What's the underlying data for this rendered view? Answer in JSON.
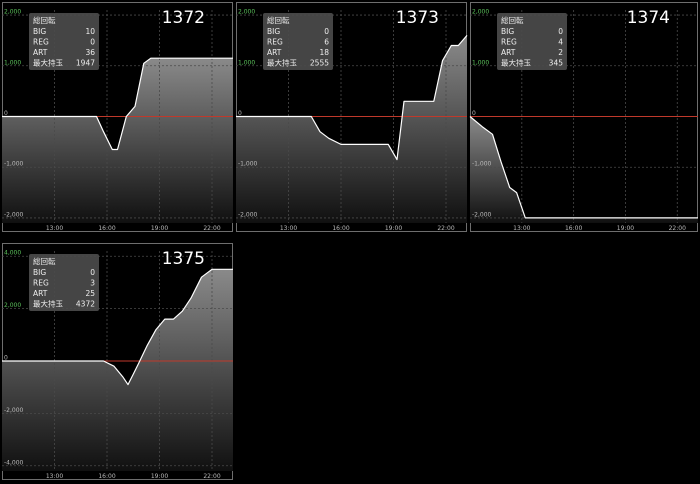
{
  "colors": {
    "background": "#000000",
    "panel_border": "#6e6e6e",
    "grid": "#4a4a4a",
    "zero_line": "#c0392b",
    "line": "#ffffff",
    "fill_top": "#8a8a8a",
    "fill_bottom": "#101010",
    "info_box": "#4b4b4b",
    "tick_positive": "#5ac05a",
    "tick_negative": "#b9b9b9"
  },
  "chart_data": [
    {
      "type": "area",
      "machine": "1372",
      "info": {
        "title": "総回転",
        "rows": [
          {
            "label": "BIG",
            "value": "10"
          },
          {
            "label": "REG",
            "value": "0"
          },
          {
            "label": "ART",
            "value": "36"
          },
          {
            "label": "最大持玉",
            "value": "1947"
          }
        ]
      },
      "xlim": [
        10,
        23.2
      ],
      "ylim": [
        -2100,
        2100
      ],
      "xticks": [
        {
          "x": 13,
          "label": "13:00"
        },
        {
          "x": 16,
          "label": "16:00"
        },
        {
          "x": 19,
          "label": "19:00"
        },
        {
          "x": 22,
          "label": "22:00"
        }
      ],
      "yticks": [
        {
          "y": 2000,
          "label": "2,000"
        },
        {
          "y": 1000,
          "label": "1,000"
        },
        {
          "y": 0,
          "label": "0"
        },
        {
          "y": -1000,
          "label": "-1,000"
        },
        {
          "y": -2000,
          "label": "-2,000"
        }
      ],
      "x": [
        10.0,
        15.4,
        15.8,
        16.3,
        16.6,
        17.1,
        17.6,
        18.1,
        18.5,
        19.0,
        20.0,
        21.0,
        22.0,
        23.2
      ],
      "y": [
        0,
        0,
        -300,
        -650,
        -650,
        0,
        200,
        1050,
        1150,
        1150,
        1150,
        1150,
        1150,
        1150
      ]
    },
    {
      "type": "area",
      "machine": "1373",
      "info": {
        "title": "総回転",
        "rows": [
          {
            "label": "BIG",
            "value": "0"
          },
          {
            "label": "REG",
            "value": "6"
          },
          {
            "label": "ART",
            "value": "18"
          },
          {
            "label": "最大持玉",
            "value": "2555"
          }
        ]
      },
      "xlim": [
        10,
        23.2
      ],
      "ylim": [
        -2100,
        2100
      ],
      "xticks": [
        {
          "x": 13,
          "label": "13:00"
        },
        {
          "x": 16,
          "label": "16:00"
        },
        {
          "x": 19,
          "label": "19:00"
        },
        {
          "x": 22,
          "label": "22:00"
        }
      ],
      "yticks": [
        {
          "y": 2000,
          "label": "2,000"
        },
        {
          "y": 1000,
          "label": "1,000"
        },
        {
          "y": 0,
          "label": "0"
        },
        {
          "y": -1000,
          "label": "-1,000"
        },
        {
          "y": -2000,
          "label": "-2,000"
        }
      ],
      "x": [
        10.0,
        13.8,
        14.3,
        14.8,
        15.3,
        16.0,
        17.0,
        18.0,
        18.7,
        19.2,
        19.6,
        20.2,
        20.8,
        21.3,
        21.8,
        22.3,
        22.7,
        23.2
      ],
      "y": [
        0,
        0,
        0,
        -300,
        -430,
        -550,
        -550,
        -550,
        -550,
        -850,
        300,
        300,
        300,
        300,
        1100,
        1400,
        1400,
        1600
      ]
    },
    {
      "type": "area",
      "machine": "1374",
      "info": {
        "title": "総回転",
        "rows": [
          {
            "label": "BIG",
            "value": "0"
          },
          {
            "label": "REG",
            "value": "4"
          },
          {
            "label": "ART",
            "value": "2"
          },
          {
            "label": "最大持玉",
            "value": "345"
          }
        ]
      },
      "xlim": [
        10,
        23.2
      ],
      "ylim": [
        -2100,
        2100
      ],
      "xticks": [
        {
          "x": 13,
          "label": "13:00"
        },
        {
          "x": 16,
          "label": "16:00"
        },
        {
          "x": 19,
          "label": "19:00"
        },
        {
          "x": 22,
          "label": "22:00"
        }
      ],
      "yticks": [
        {
          "y": 2000,
          "label": "2,000"
        },
        {
          "y": 1000,
          "label": "1,000"
        },
        {
          "y": 0,
          "label": "0"
        },
        {
          "y": -1000,
          "label": "-1,000"
        },
        {
          "y": -2000,
          "label": "-2,000"
        }
      ],
      "x": [
        10.0,
        10.7,
        11.3,
        11.8,
        12.3,
        12.7,
        13.2,
        15.0,
        18.0,
        21.0,
        23.2
      ],
      "y": [
        0,
        -200,
        -350,
        -900,
        -1400,
        -1500,
        -2000,
        -2000,
        -2000,
        -2000,
        -2000
      ]
    },
    {
      "type": "area",
      "machine": "1375",
      "info": {
        "title": "総回転",
        "rows": [
          {
            "label": "BIG",
            "value": "0"
          },
          {
            "label": "REG",
            "value": "3"
          },
          {
            "label": "ART",
            "value": "25"
          },
          {
            "label": "最大持玉",
            "value": "4372"
          }
        ]
      },
      "xlim": [
        10,
        23.2
      ],
      "ylim": [
        -4200,
        4200
      ],
      "xticks": [
        {
          "x": 13,
          "label": "13:00"
        },
        {
          "x": 16,
          "label": "16:00"
        },
        {
          "x": 19,
          "label": "19:00"
        },
        {
          "x": 22,
          "label": "22:00"
        }
      ],
      "yticks": [
        {
          "y": 4000,
          "label": "4,000"
        },
        {
          "y": 2000,
          "label": "2,000"
        },
        {
          "y": 0,
          "label": "0"
        },
        {
          "y": -2000,
          "label": "-2,000"
        },
        {
          "y": -4000,
          "label": "-4,000"
        }
      ],
      "x": [
        10.0,
        15.2,
        15.8,
        16.4,
        16.9,
        17.2,
        17.5,
        17.8,
        18.3,
        18.8,
        19.3,
        19.8,
        20.3,
        20.8,
        21.4,
        22.0,
        22.6,
        23.2
      ],
      "y": [
        0,
        0,
        0,
        -200,
        -600,
        -900,
        -500,
        -100,
        600,
        1200,
        1600,
        1600,
        1900,
        2400,
        3200,
        3500,
        3500,
        3500
      ]
    }
  ]
}
